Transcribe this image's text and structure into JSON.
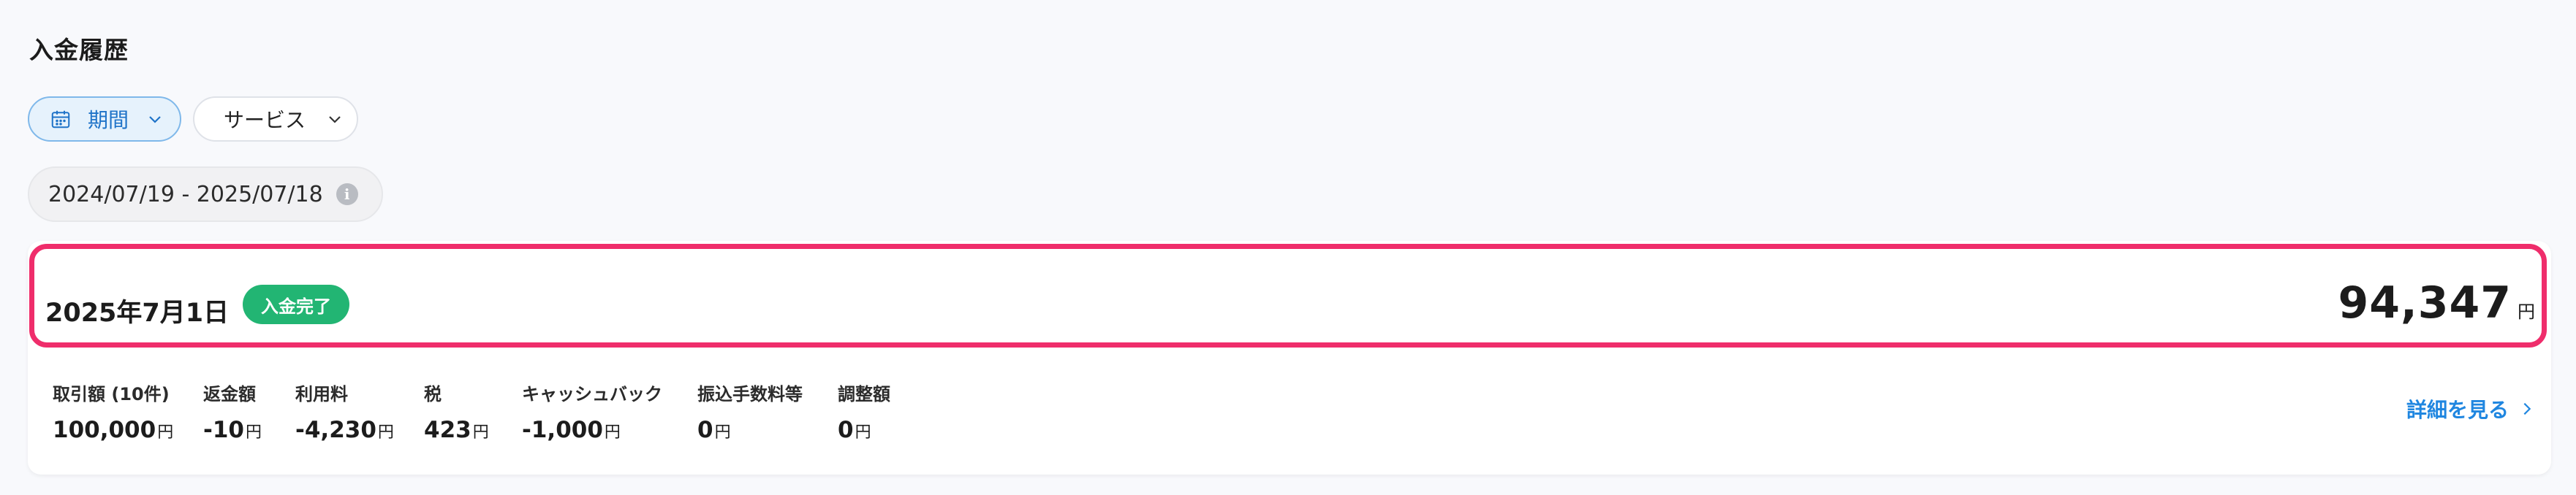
{
  "page": {
    "title": "入金履歴"
  },
  "filters": {
    "period_label": "期間",
    "service_label": "サービス"
  },
  "date_range": {
    "text": "2024/07/19 - 2025/07/18",
    "info_icon": "info-icon"
  },
  "deposit": {
    "date": "2025年7月1日",
    "status": "入金完了",
    "amount": "94,347",
    "currency": "円",
    "breakdown": [
      {
        "label": "取引額 (10件)",
        "value": "100,000"
      },
      {
        "label": "返金額",
        "value": "-10"
      },
      {
        "label": "利用料",
        "value": "-4,230"
      },
      {
        "label": "税",
        "value": "423"
      },
      {
        "label": "キャッシュバック",
        "value": "-1,000"
      },
      {
        "label": "振込手数料等",
        "value": "0"
      },
      {
        "label": "調整額",
        "value": "0"
      }
    ],
    "detail_link": "詳細を見る"
  },
  "colors": {
    "accent": "#1f86e0",
    "highlight_border": "#ef2d6b",
    "status_green": "#22b573",
    "period_bg": "#e6f2fc"
  }
}
